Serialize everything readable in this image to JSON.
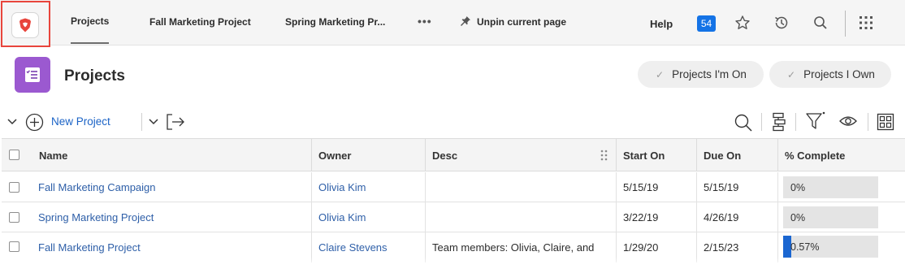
{
  "topbar": {
    "tabs": [
      {
        "label": "Projects",
        "active": true
      },
      {
        "label": "Fall Marketing Project",
        "active": false
      },
      {
        "label": "Spring Marketing Pr...",
        "active": false
      }
    ],
    "more_label": "•••",
    "unpin_label": "Unpin current page",
    "help_label": "Help",
    "notification_count": "54",
    "icons": [
      "app-logo-icon",
      "pin-icon",
      "star-icon",
      "history-icon",
      "search-icon",
      "apps-grid-icon"
    ]
  },
  "page": {
    "title": "Projects",
    "filters": [
      {
        "label": "Projects I'm On"
      },
      {
        "label": "Projects I Own"
      }
    ]
  },
  "toolbar": {
    "new_project_label": "New Project",
    "icons": [
      "collapse-chevron-icon",
      "add-circle-icon",
      "more-chevron-icon",
      "export-icon",
      "search-icon",
      "group-icon",
      "filter-icon",
      "view-eye-icon",
      "layout-grid-icon"
    ]
  },
  "grid": {
    "columns": [
      "Name",
      "Owner",
      "Desc",
      "Start On",
      "Due On",
      "% Complete"
    ],
    "rows": [
      {
        "name": "Fall Marketing Campaign",
        "owner": "Olivia Kim",
        "desc": "",
        "start": "5/15/19",
        "due": "5/15/19",
        "complete_label": "0%",
        "complete_fraction": 0.0
      },
      {
        "name": "Spring Marketing Project",
        "owner": "Olivia Kim",
        "desc": "",
        "start": "3/22/19",
        "due": "4/26/19",
        "complete_label": "0%",
        "complete_fraction": 0.0
      },
      {
        "name": "Fall Marketing Project",
        "owner": "Claire Stevens",
        "desc": "Team members: Olivia, Claire, and",
        "start": "1/29/20",
        "due": "2/15/23",
        "complete_label": "0.57%",
        "complete_fraction": 0.0057
      }
    ]
  },
  "colors": {
    "accent": "#1473e6",
    "link": "#2e5fa8",
    "highlight_border": "#e8453c",
    "page_icon": "#9b59d0",
    "progress_fill": "#1a66d1"
  }
}
